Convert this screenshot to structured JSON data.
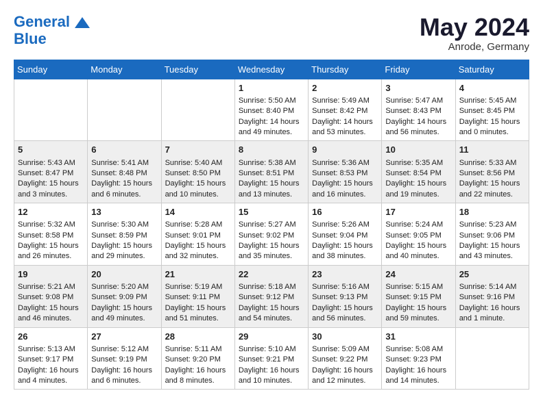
{
  "header": {
    "logo_line1": "General",
    "logo_line2": "Blue",
    "month_year": "May 2024",
    "location": "Anrode, Germany"
  },
  "days_of_week": [
    "Sunday",
    "Monday",
    "Tuesday",
    "Wednesday",
    "Thursday",
    "Friday",
    "Saturday"
  ],
  "weeks": [
    [
      {
        "day": "",
        "info": ""
      },
      {
        "day": "",
        "info": ""
      },
      {
        "day": "",
        "info": ""
      },
      {
        "day": "1",
        "info": "Sunrise: 5:50 AM\nSunset: 8:40 PM\nDaylight: 14 hours\nand 49 minutes."
      },
      {
        "day": "2",
        "info": "Sunrise: 5:49 AM\nSunset: 8:42 PM\nDaylight: 14 hours\nand 53 minutes."
      },
      {
        "day": "3",
        "info": "Sunrise: 5:47 AM\nSunset: 8:43 PM\nDaylight: 14 hours\nand 56 minutes."
      },
      {
        "day": "4",
        "info": "Sunrise: 5:45 AM\nSunset: 8:45 PM\nDaylight: 15 hours\nand 0 minutes."
      }
    ],
    [
      {
        "day": "5",
        "info": "Sunrise: 5:43 AM\nSunset: 8:47 PM\nDaylight: 15 hours\nand 3 minutes."
      },
      {
        "day": "6",
        "info": "Sunrise: 5:41 AM\nSunset: 8:48 PM\nDaylight: 15 hours\nand 6 minutes."
      },
      {
        "day": "7",
        "info": "Sunrise: 5:40 AM\nSunset: 8:50 PM\nDaylight: 15 hours\nand 10 minutes."
      },
      {
        "day": "8",
        "info": "Sunrise: 5:38 AM\nSunset: 8:51 PM\nDaylight: 15 hours\nand 13 minutes."
      },
      {
        "day": "9",
        "info": "Sunrise: 5:36 AM\nSunset: 8:53 PM\nDaylight: 15 hours\nand 16 minutes."
      },
      {
        "day": "10",
        "info": "Sunrise: 5:35 AM\nSunset: 8:54 PM\nDaylight: 15 hours\nand 19 minutes."
      },
      {
        "day": "11",
        "info": "Sunrise: 5:33 AM\nSunset: 8:56 PM\nDaylight: 15 hours\nand 22 minutes."
      }
    ],
    [
      {
        "day": "12",
        "info": "Sunrise: 5:32 AM\nSunset: 8:58 PM\nDaylight: 15 hours\nand 26 minutes."
      },
      {
        "day": "13",
        "info": "Sunrise: 5:30 AM\nSunset: 8:59 PM\nDaylight: 15 hours\nand 29 minutes."
      },
      {
        "day": "14",
        "info": "Sunrise: 5:28 AM\nSunset: 9:01 PM\nDaylight: 15 hours\nand 32 minutes."
      },
      {
        "day": "15",
        "info": "Sunrise: 5:27 AM\nSunset: 9:02 PM\nDaylight: 15 hours\nand 35 minutes."
      },
      {
        "day": "16",
        "info": "Sunrise: 5:26 AM\nSunset: 9:04 PM\nDaylight: 15 hours\nand 38 minutes."
      },
      {
        "day": "17",
        "info": "Sunrise: 5:24 AM\nSunset: 9:05 PM\nDaylight: 15 hours\nand 40 minutes."
      },
      {
        "day": "18",
        "info": "Sunrise: 5:23 AM\nSunset: 9:06 PM\nDaylight: 15 hours\nand 43 minutes."
      }
    ],
    [
      {
        "day": "19",
        "info": "Sunrise: 5:21 AM\nSunset: 9:08 PM\nDaylight: 15 hours\nand 46 minutes."
      },
      {
        "day": "20",
        "info": "Sunrise: 5:20 AM\nSunset: 9:09 PM\nDaylight: 15 hours\nand 49 minutes."
      },
      {
        "day": "21",
        "info": "Sunrise: 5:19 AM\nSunset: 9:11 PM\nDaylight: 15 hours\nand 51 minutes."
      },
      {
        "day": "22",
        "info": "Sunrise: 5:18 AM\nSunset: 9:12 PM\nDaylight: 15 hours\nand 54 minutes."
      },
      {
        "day": "23",
        "info": "Sunrise: 5:16 AM\nSunset: 9:13 PM\nDaylight: 15 hours\nand 56 minutes."
      },
      {
        "day": "24",
        "info": "Sunrise: 5:15 AM\nSunset: 9:15 PM\nDaylight: 15 hours\nand 59 minutes."
      },
      {
        "day": "25",
        "info": "Sunrise: 5:14 AM\nSunset: 9:16 PM\nDaylight: 16 hours\nand 1 minute."
      }
    ],
    [
      {
        "day": "26",
        "info": "Sunrise: 5:13 AM\nSunset: 9:17 PM\nDaylight: 16 hours\nand 4 minutes."
      },
      {
        "day": "27",
        "info": "Sunrise: 5:12 AM\nSunset: 9:19 PM\nDaylight: 16 hours\nand 6 minutes."
      },
      {
        "day": "28",
        "info": "Sunrise: 5:11 AM\nSunset: 9:20 PM\nDaylight: 16 hours\nand 8 minutes."
      },
      {
        "day": "29",
        "info": "Sunrise: 5:10 AM\nSunset: 9:21 PM\nDaylight: 16 hours\nand 10 minutes."
      },
      {
        "day": "30",
        "info": "Sunrise: 5:09 AM\nSunset: 9:22 PM\nDaylight: 16 hours\nand 12 minutes."
      },
      {
        "day": "31",
        "info": "Sunrise: 5:08 AM\nSunset: 9:23 PM\nDaylight: 16 hours\nand 14 minutes."
      },
      {
        "day": "",
        "info": ""
      }
    ]
  ]
}
